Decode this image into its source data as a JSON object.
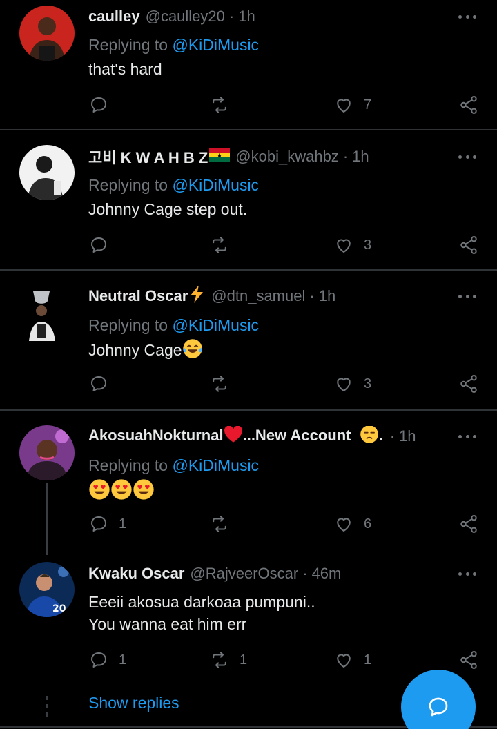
{
  "colors": {
    "background": "#000000",
    "text": "#e7e9ea",
    "muted": "#71767b",
    "accent": "#1d9bf0",
    "divider": "#2f3336"
  },
  "tweets": [
    {
      "name": "caulley",
      "handle": "@caulley20",
      "time": "1h",
      "reply_prefix": "Replying to ",
      "reply_to": "@KiDiMusic",
      "text": "that's hard",
      "likes": "7",
      "avatar_icon": "avatar-man-red-bg"
    },
    {
      "name": "고비 K W A H B Z",
      "name_emoji": "ghana-flag",
      "handle": "@kobi_kwahbz",
      "time": "1h",
      "reply_prefix": "Replying to ",
      "reply_to": "@KiDiMusic",
      "text": "Johnny Cage step out.",
      "likes": "3",
      "avatar_icon": "avatar-grayscale-player"
    },
    {
      "name": "Neutral Oscar",
      "name_emoji": "lightning-emoji",
      "handle": "@dtn_samuel",
      "time": "1h",
      "reply_prefix": "Replying to ",
      "reply_to": "@KiDiMusic",
      "text": "Johnny Cage",
      "text_emoji": "tears-of-joy-emoji",
      "likes": "3",
      "avatar_icon": "avatar-trophy-player"
    },
    {
      "name_part1": "AkosuahNokturnal",
      "name_emoji": "red-heart-emoji",
      "name_part2": "...New Account",
      "name_emoji2": "pensive-emoji",
      "name_suffix": ".",
      "time": "1h",
      "reply_prefix": "Replying to ",
      "reply_to": "@KiDiMusic",
      "text_emoji": "heart-eyes-emoji x3",
      "replies": "1",
      "likes": "6",
      "avatar_icon": "avatar-woman-purple-bg"
    },
    {
      "name": "Kwaku Oscar",
      "handle": "@RajveerOscar",
      "time": "46m",
      "text_line1": "Eeeii akosua darkoaa pumpuni..",
      "text_line2": "You wanna eat him err",
      "replies": "1",
      "retweets": "1",
      "likes": "1",
      "avatar_icon": "avatar-chelsea-player"
    }
  ],
  "show_replies": "Show replies",
  "compose_icon": "reply-compose-icon"
}
